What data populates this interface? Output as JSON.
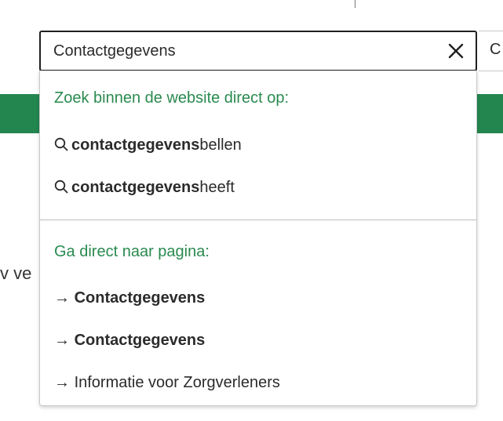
{
  "search": {
    "value": "Contactgegevens",
    "side_button_label": "C"
  },
  "background": {
    "partial_text": "v ve"
  },
  "dropdown": {
    "search_heading": "Zoek binnen de website direct op:",
    "suggestions": [
      {
        "bold": "contactgegevens",
        "rest": "bellen"
      },
      {
        "bold": "contactgegevens",
        "rest": "heeft"
      }
    ],
    "pages_heading": "Ga direct naar pagina:",
    "pages": [
      {
        "arrow": "→",
        "label": "Contactgegevens",
        "bold": true
      },
      {
        "arrow": "→",
        "label": "Contactgegevens",
        "bold": true
      },
      {
        "arrow": "→",
        "label": "Informatie voor Zorgverleners",
        "bold": false
      }
    ]
  },
  "colors": {
    "accent_green": "#2a8a4f",
    "band_green": "#23864f"
  },
  "icons": {
    "clear": "close-icon",
    "suggestion": "search-icon"
  }
}
